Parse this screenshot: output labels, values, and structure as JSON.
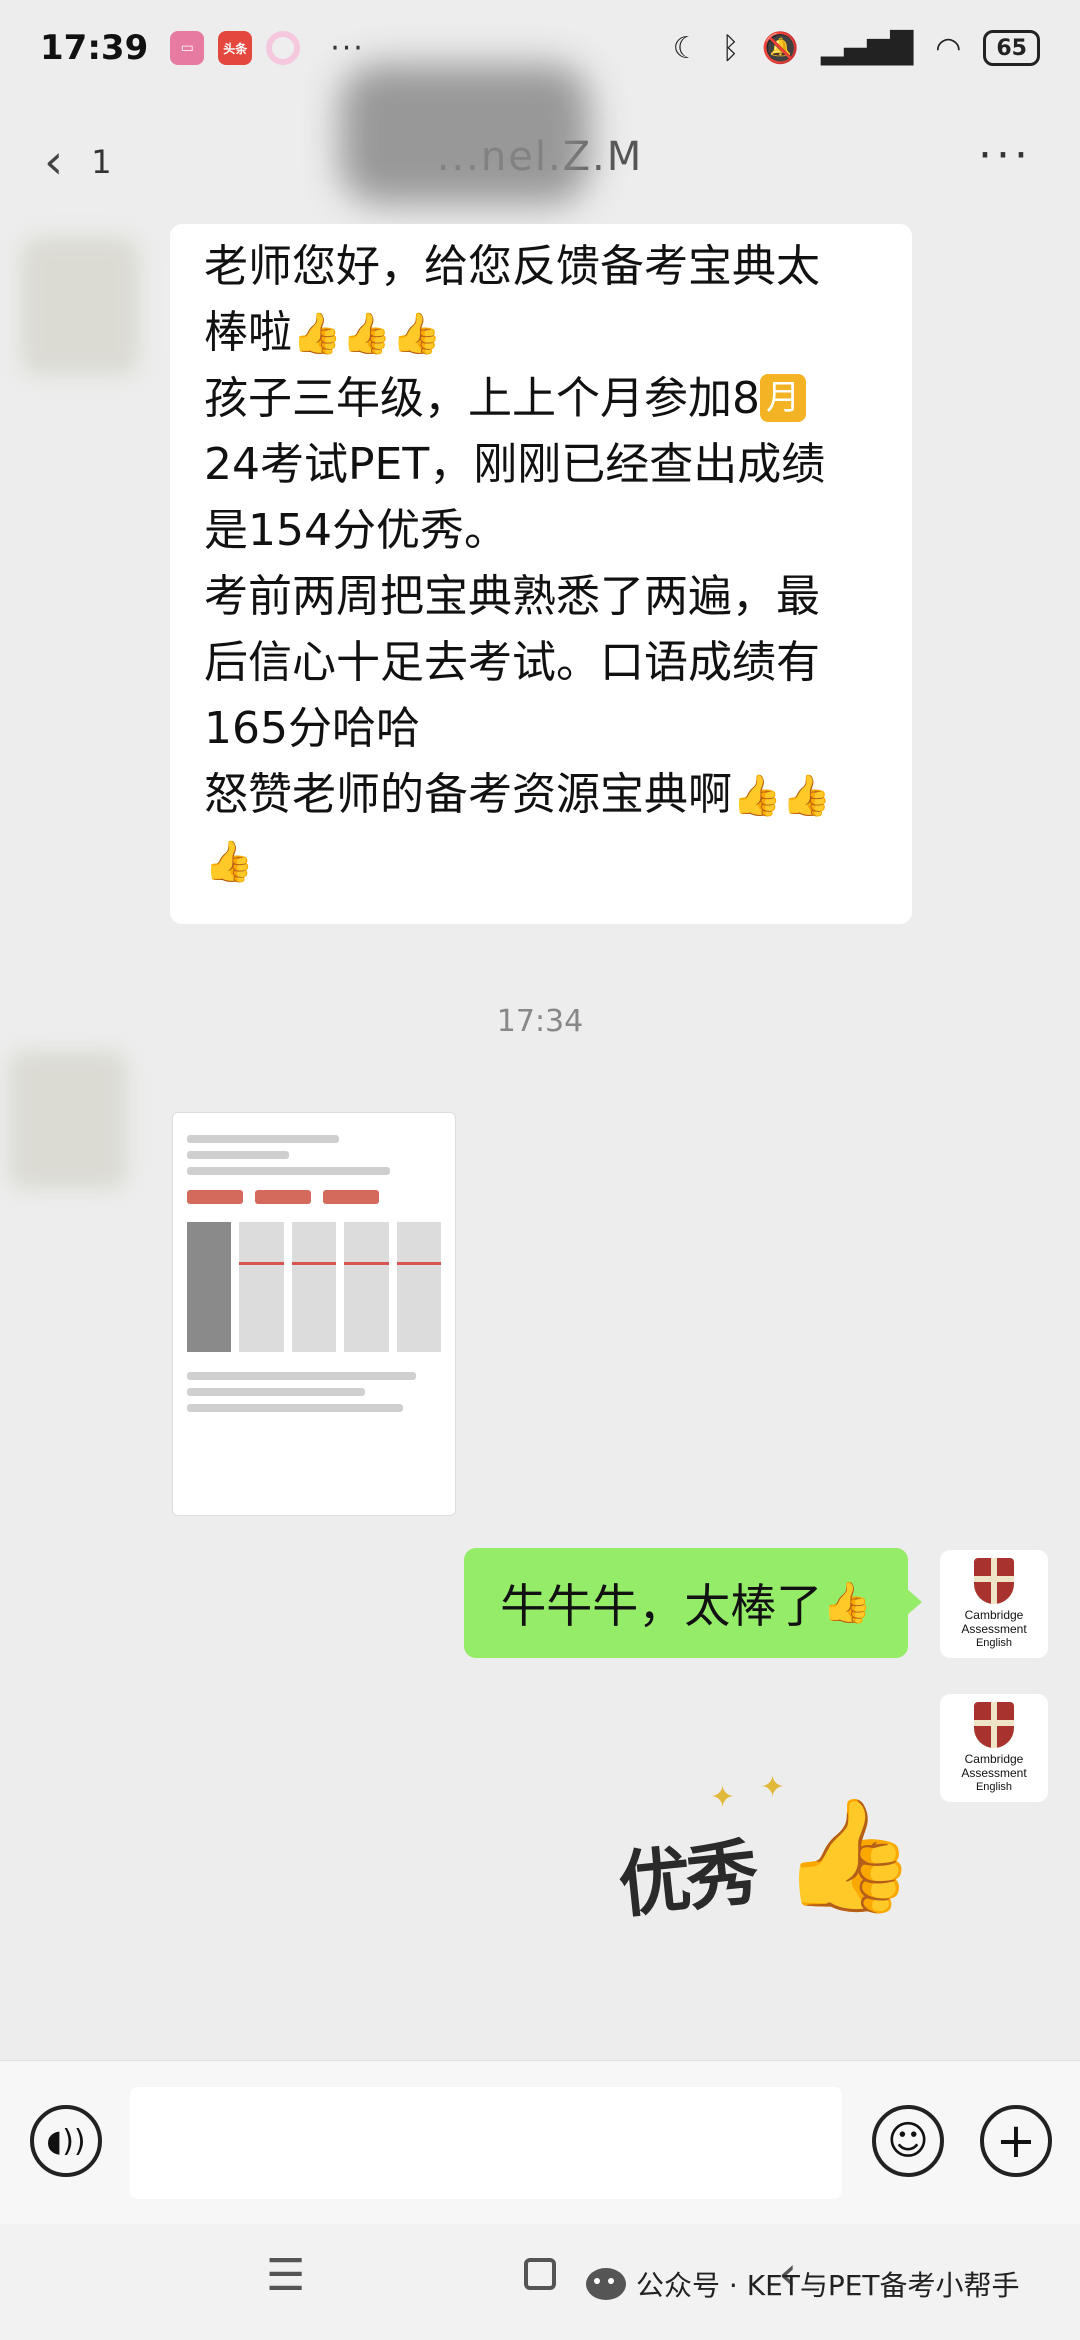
{
  "status_bar": {
    "time": "17:39",
    "app_badges": [
      "bilibili",
      "头条",
      ""
    ],
    "more": "···",
    "battery": "65"
  },
  "header": {
    "back_count": "1",
    "contact_name": "...nel.Z.M",
    "more": "···"
  },
  "messages": {
    "received_lines": [
      "老师您好，给您反馈备考宝典太",
      "棒啦",
      "孩子三年级，上上个月参加8",
      "24考试PET，刚刚已经查出成绩",
      "是154分优秀。",
      "考前两周把宝典熟悉了两遍，最",
      "后信心十足去考试。口语成绩有",
      "165分哈哈",
      "怒赞老师的备考资源宝典啊",
      ""
    ],
    "month_badge": "月",
    "time_divider": "17:34",
    "sent_text": "牛牛牛，太棒了",
    "sticker_text": "优秀"
  },
  "avatar": {
    "line1": "Cambridge",
    "line2": "Assessment",
    "line3": "English"
  },
  "input": {
    "placeholder": ""
  },
  "watermark": "公众号 · KET与PET备考小帮手",
  "icons": {
    "thumbs_up": "👍",
    "voice": "voice-icon",
    "emoji": "emoji-icon",
    "plus": "plus-icon"
  }
}
